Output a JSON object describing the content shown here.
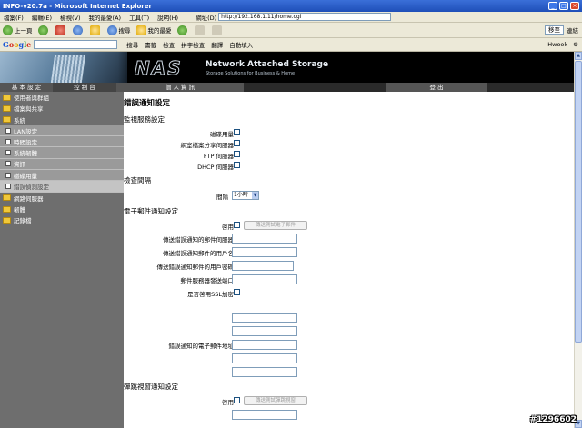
{
  "window": {
    "title": "INFO-v20.7a - Microsoft Internet Explorer"
  },
  "menu": {
    "items": [
      "檔案(F)",
      "編輯(E)",
      "檢視(V)",
      "我的最愛(A)",
      "工具(T)",
      "說明(H)"
    ],
    "address_label": "網址(D)",
    "address": "http://192.168.1.11/home.cgi"
  },
  "toolbar": {
    "back": "上一頁",
    "search": "搜尋",
    "favorites": "我的最愛",
    "go": "移至",
    "links": "連結"
  },
  "googlebar": {
    "logo": "Google",
    "items": [
      "搜尋",
      "書籤",
      "檢查",
      "拼字檢查",
      "翻譯",
      "自動填入"
    ],
    "user": "Hwook"
  },
  "banner": {
    "logo": "NAS",
    "title": "Network Attached Storage",
    "subtitle": "Storage Solutions for Business & Home"
  },
  "nav": {
    "tab1": "基 本 設 定",
    "tab2": "控 制 台",
    "tab3": "個 人 資 訊",
    "tab4": "登 出"
  },
  "sidebar": {
    "items": [
      {
        "label": "使用者與群組",
        "type": "top"
      },
      {
        "label": "檔案與共享",
        "type": "top"
      },
      {
        "label": "系統",
        "type": "top"
      },
      {
        "label": "LAN設定",
        "type": "sub"
      },
      {
        "label": "時間設定",
        "type": "sub"
      },
      {
        "label": "系統韌體",
        "type": "sub"
      },
      {
        "label": "資訊",
        "type": "sub"
      },
      {
        "label": "磁碟用量",
        "type": "sub"
      },
      {
        "label": "錯誤偵測設定",
        "type": "sub_active"
      },
      {
        "label": "網路伺服器",
        "type": "top"
      },
      {
        "label": "韌體",
        "type": "top"
      },
      {
        "label": "記錄檔",
        "type": "top"
      }
    ]
  },
  "content": {
    "title": "錯誤通知設定",
    "monitor_section": "監視服務設定",
    "monitor_items": [
      "磁碟用量",
      "網室檔案分享伺服器",
      "FTP 伺服器",
      "DHCP 伺服器"
    ],
    "interval_section": "檢查間隔",
    "interval_label": "間隔",
    "interval_value": "1小時",
    "email_section": "電子郵件通知設定",
    "enable_label": "啓用",
    "email_test_btn": "傳送測試電子郵件",
    "smtp_server_label": "傳送錯誤通知的郵件伺服器",
    "smtp_user_label": "傳送錯誤通知郵件的用戶名",
    "smtp_pass_label": "傳送錯誤通知郵件的用戶密碼",
    "smtp_port_label": "郵件服務器發送端口",
    "ssl_label": "是否啓用SSL加密",
    "recipient_label": "錯誤通知的電子郵件地址",
    "msg_section": "彈跳視窗通知設定",
    "msg_enable_label": "啓用",
    "msg_test_btn": "傳送測試彈跳視窗"
  },
  "watermark": "#1296602"
}
